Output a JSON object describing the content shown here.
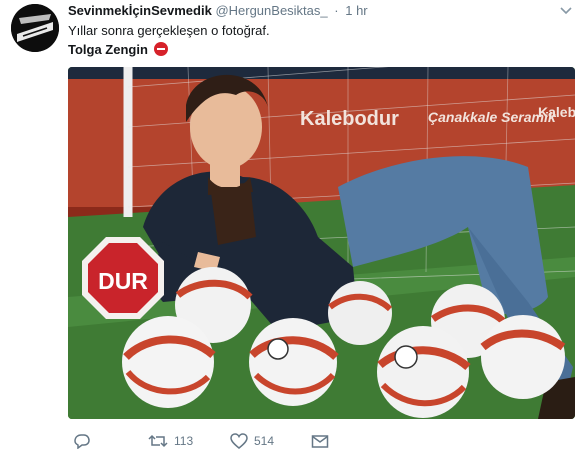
{
  "tweet": {
    "display_name": "SevinmekİçinSevmedik",
    "handle": "@HergunBesiktas_",
    "separator": "·",
    "time": "1 hr",
    "text_line1": "Yıllar sonra gerçekleşen o fotoğraf.",
    "text_line2": "Tolga Zengin"
  },
  "photo": {
    "ad_boards": [
      "Kalebodur",
      "Çanakkale Seramik",
      "Kalebodur"
    ],
    "stop_sign": "DUR"
  },
  "actions": {
    "retweets": "113",
    "likes": "514"
  },
  "icons": {
    "reply": "reply-icon",
    "retweet": "retweet-icon",
    "like": "heart-icon",
    "dm": "envelope-icon",
    "more": "chevron-down-icon",
    "no_entry": "no-entry-icon"
  },
  "colors": {
    "text": "#14171a",
    "muted": "#657786",
    "no_entry": "#d6222a"
  }
}
